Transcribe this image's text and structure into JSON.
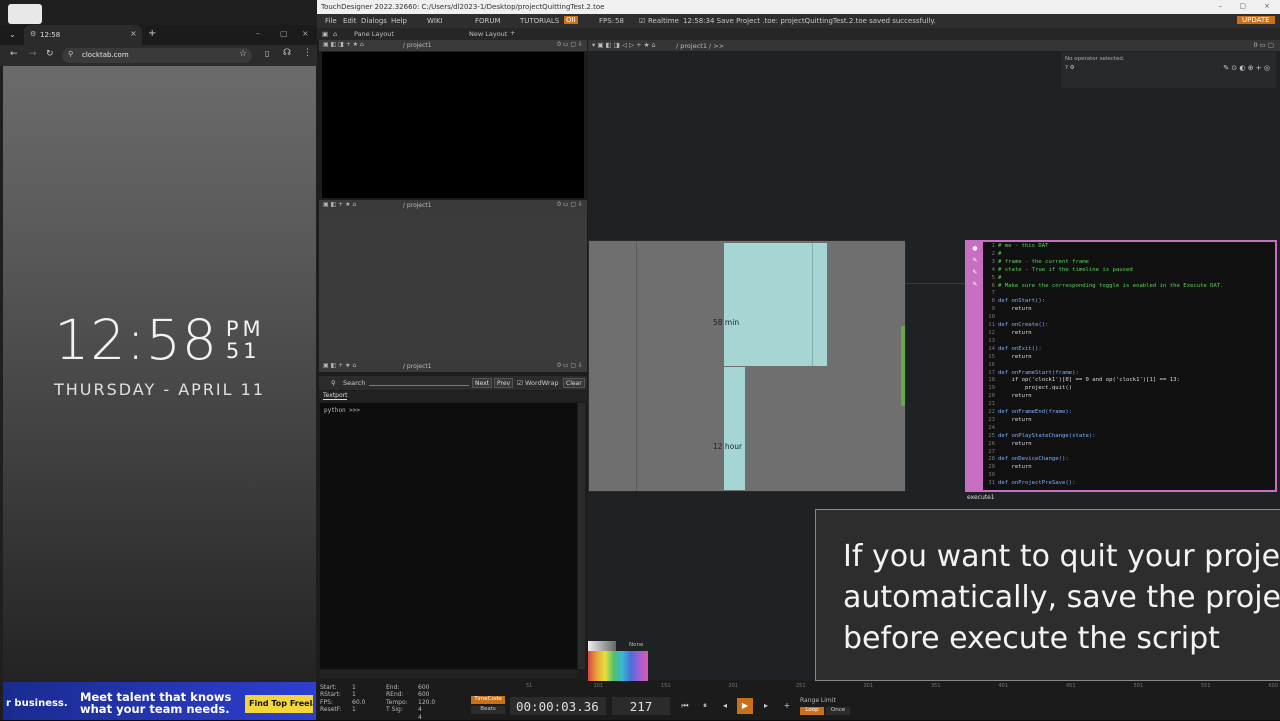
{
  "browser": {
    "tab_title": "12:58",
    "url": "clocktab.com",
    "clock": {
      "hhmm": "12:58",
      "ampm": "PM",
      "seconds": "51",
      "date": "THURSDAY - APRIL 11"
    },
    "ad": {
      "brand": "r business.",
      "line1": "Meet talent that knows",
      "line2": "what your team needs.",
      "button": "Find Top Freelan"
    }
  },
  "td": {
    "title": "TouchDesigner 2022.32660: C:/Users/dl2023-1/Desktop/projectQuittingTest.2.toe",
    "menu": [
      "File",
      "Edit",
      "Dialogs",
      "Help"
    ],
    "top_links": [
      "WIKI",
      "FORUM",
      "TUTORIALS"
    ],
    "oii": "OII",
    "fps_label": "FPS:",
    "fps_value": "58",
    "realtime": "Realtime",
    "status": "12:58:34 Save Project .toe: projectQuittingTest.2.toe saved successfully.",
    "update": "UPDATE",
    "pane_layout": "Pane Layout",
    "new_layout": "New Layout",
    "path": "/ project1",
    "net_path": "/ project1 / >>",
    "param_none": "No operator selected.",
    "search": "Search",
    "next": "Next",
    "prev": "Prev",
    "wordwrap": "WordWrap",
    "clear": "Clear",
    "textport_tab": "Textport",
    "prompt": "python >>>",
    "viewer": {
      "min_label": "58 min",
      "hour_label": "12 hour"
    },
    "exec_name": "execute1",
    "palette_none": "None",
    "subtitle": "If you want to quit your projec\nautomatically, save the project\nbefore execute the script",
    "timeline": {
      "stats_left": [
        "Start:",
        "RStart:",
        "FPS:",
        "ResetF:"
      ],
      "stats_left_v": [
        "1",
        "1",
        "60.0",
        "1"
      ],
      "stats_right": [
        "End:",
        "REnd:",
        "Tempo:",
        "T Sig:"
      ],
      "stats_right_v": [
        "600",
        "600",
        "120.0",
        "4  4"
      ],
      "timecode_label": "TimeCode",
      "beats_label": "Beats",
      "timecode": "00:00:03.36",
      "frame": "217",
      "range_limit": "Range Limit",
      "loop": "Loop",
      "once": "Once",
      "ruler": [
        "51",
        "101",
        "151",
        "201",
        "251",
        "301",
        "351",
        "401",
        "451",
        "501",
        "551",
        "600"
      ]
    }
  },
  "code_lines": [
    {
      "n": "1",
      "t": "# me - this DAT",
      "c": "cm"
    },
    {
      "n": "2",
      "t": "#",
      "c": "cm"
    },
    {
      "n": "3",
      "t": "# frame - the current frame",
      "c": "cm"
    },
    {
      "n": "4",
      "t": "# state - True if the timeline is paused",
      "c": "cm"
    },
    {
      "n": "5",
      "t": "#",
      "c": "cm"
    },
    {
      "n": "6",
      "t": "# Make sure the corresponding toggle is enabled in the Execute DAT.",
      "c": "cm"
    },
    {
      "n": "7",
      "t": "",
      "c": ""
    },
    {
      "n": "8",
      "t": "def onStart():",
      "c": "kw"
    },
    {
      "n": "9",
      "t": "    return",
      "c": ""
    },
    {
      "n": "10",
      "t": "",
      "c": ""
    },
    {
      "n": "11",
      "t": "def onCreate():",
      "c": "kw"
    },
    {
      "n": "12",
      "t": "    return",
      "c": ""
    },
    {
      "n": "13",
      "t": "",
      "c": ""
    },
    {
      "n": "14",
      "t": "def onExit():",
      "c": "kw"
    },
    {
      "n": "15",
      "t": "    return",
      "c": ""
    },
    {
      "n": "16",
      "t": "",
      "c": ""
    },
    {
      "n": "17",
      "t": "def onFrameStart(frame):",
      "c": "kw"
    },
    {
      "n": "18",
      "t": "    if op('clock1')[0] == 0 and op('clock1')[1] == 13:",
      "c": ""
    },
    {
      "n": "19",
      "t": "        project.quit()",
      "c": ""
    },
    {
      "n": "20",
      "t": "    return",
      "c": ""
    },
    {
      "n": "21",
      "t": "",
      "c": ""
    },
    {
      "n": "22",
      "t": "def onFrameEnd(frame):",
      "c": "kw"
    },
    {
      "n": "23",
      "t": "    return",
      "c": ""
    },
    {
      "n": "24",
      "t": "",
      "c": ""
    },
    {
      "n": "25",
      "t": "def onPlayStateChange(state):",
      "c": "kw"
    },
    {
      "n": "26",
      "t": "    return",
      "c": ""
    },
    {
      "n": "27",
      "t": "",
      "c": ""
    },
    {
      "n": "28",
      "t": "def onDeviceChange():",
      "c": "kw"
    },
    {
      "n": "29",
      "t": "    return",
      "c": ""
    },
    {
      "n": "30",
      "t": "",
      "c": ""
    },
    {
      "n": "31",
      "t": "def onProjectPreSave():",
      "c": "kw"
    }
  ],
  "colors": {
    "exec_border": "#c86fc4",
    "bar_fill": "#a5d6d4",
    "accent_orange": "#c9711a"
  }
}
